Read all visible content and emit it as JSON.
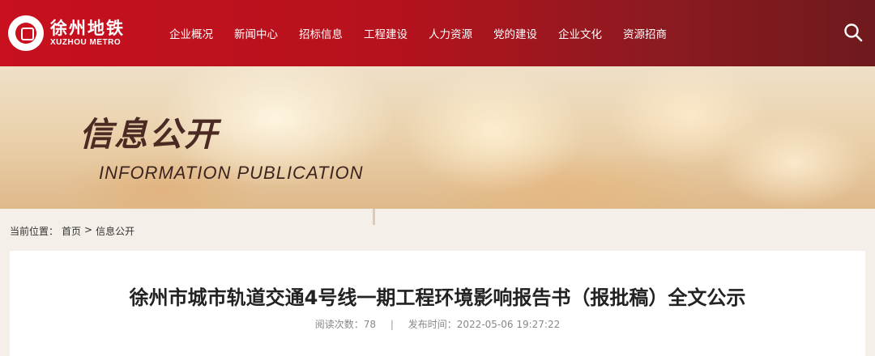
{
  "header": {
    "logo_cn": "徐州地铁",
    "logo_en": "XUZHOU METRO",
    "nav": [
      {
        "label": "企业概况"
      },
      {
        "label": "新闻中心"
      },
      {
        "label": "招标信息"
      },
      {
        "label": "工程建设"
      },
      {
        "label": "人力资源"
      },
      {
        "label": "党的建设"
      },
      {
        "label": "企业文化"
      },
      {
        "label": "资源招商"
      }
    ],
    "search_icon": "search-icon",
    "brand_color": "#c8101e"
  },
  "banner": {
    "title_cn": "信息公开",
    "title_en": "INFORMATION  PUBLICATION"
  },
  "breadcrumb": {
    "prefix": "当前位置：",
    "home": "首页",
    "separator": ">",
    "current": "信息公开"
  },
  "article": {
    "title": "徐州市城市轨道交通4号线一期工程环境影响报告书（报批稿）全文公示",
    "views_label": "阅读次数：",
    "views": "78",
    "meta_separator": "|",
    "published_label": "发布时间：",
    "published": "2022-05-06 19:27:22"
  }
}
